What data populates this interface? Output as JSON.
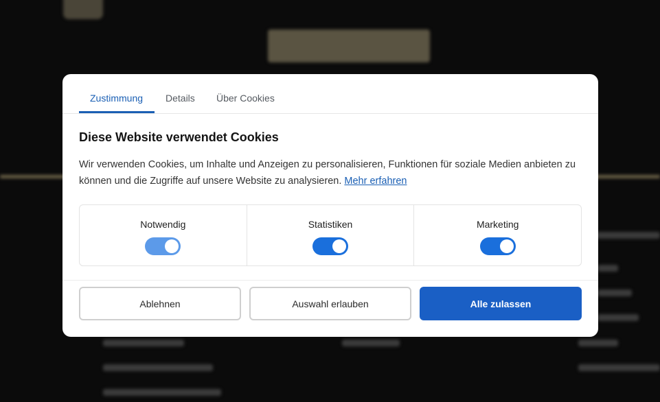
{
  "dialog": {
    "tabs": [
      {
        "label": "Zustimmung"
      },
      {
        "label": "Details"
      },
      {
        "label": "Über Cookies"
      }
    ],
    "title": "Diese Website verwendet Cookies",
    "description": "Wir verwenden Cookies, um Inhalte und Anzeigen zu personalisieren, Funktionen für soziale Medien anbieten zu können und die Zugriffe auf unsere Website zu analysieren.",
    "learn_more": "Mehr erfahren",
    "categories": [
      {
        "label": "Notwendig",
        "enabled": true,
        "locked": true
      },
      {
        "label": "Statistiken",
        "enabled": true,
        "locked": false
      },
      {
        "label": "Marketing",
        "enabled": true,
        "locked": false
      }
    ],
    "buttons": {
      "deny": "Ablehnen",
      "allow_selection": "Auswahl erlauben",
      "allow_all": "Alle zulassen"
    }
  },
  "colors": {
    "accent": "#1a5fb4",
    "toggle_on": "#1a6fdc",
    "toggle_locked": "#5c9ae9",
    "overlay": "#0b0b0b"
  }
}
